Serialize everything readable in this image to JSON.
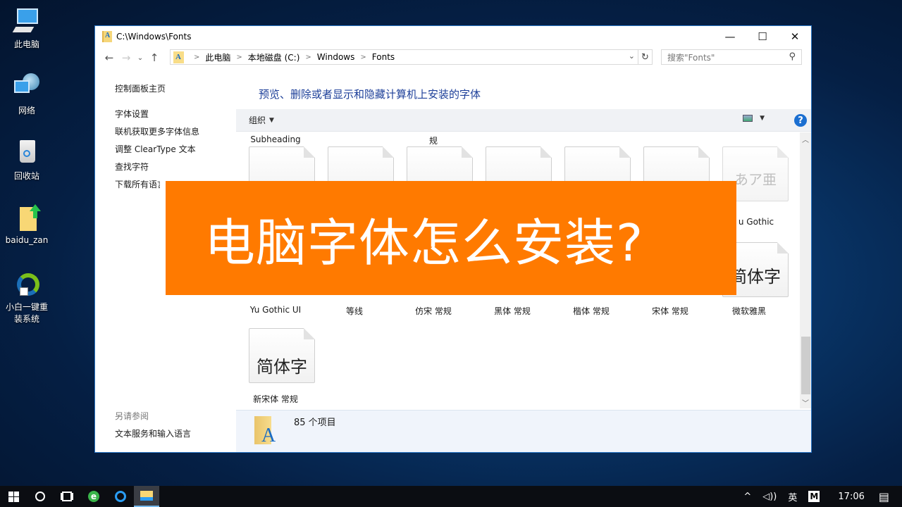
{
  "desktop": {
    "icons": [
      {
        "label": "此电脑",
        "icon": "computer-icon"
      },
      {
        "label": "网络",
        "icon": "network-icon"
      },
      {
        "label": "回收站",
        "icon": "recycle-bin-icon"
      },
      {
        "label": "baidu_zan",
        "icon": "folder-icon"
      },
      {
        "label": "小白一键重装系统",
        "icon": "reinstall-app-icon"
      }
    ]
  },
  "window": {
    "title": "C:\\Windows\\Fonts",
    "controls": {
      "minimize": "—",
      "maximize": "☐",
      "close": "✕"
    },
    "nav": {
      "back": "←",
      "forward": "→",
      "recent": "⌄",
      "up": "↑"
    },
    "breadcrumb": [
      "此电脑",
      "本地磁盘 (C:)",
      "Windows",
      "Fonts"
    ],
    "search_placeholder": "搜索\"Fonts\"",
    "left_pane": {
      "home": "控制面板主页",
      "links": [
        "字体设置",
        "联机获取更多字体信息",
        "调整 ClearType 文本",
        "查找字符",
        "下载所有语言的字体"
      ],
      "see_also_header": "另请参阅",
      "see_also_links": [
        "文本服务和输入语言"
      ]
    },
    "description": "预览、删除或者显示和隐藏计算机上安装的字体",
    "toolbar": {
      "organize": "组织",
      "help": "?"
    },
    "partial_labels": [
      "Subheading",
      "规"
    ],
    "top_row_tail_label": "u Gothic",
    "top_row_glyphs": [
      "",
      "",
      "",
      "",
      "",
      "",
      "あア亜"
    ],
    "fonts": [
      {
        "name": "Yu Gothic UI",
        "glyph": ""
      },
      {
        "name": "等线",
        "glyph": ""
      },
      {
        "name": "仿宋 常规",
        "glyph": ""
      },
      {
        "name": "黑体 常规",
        "glyph": ""
      },
      {
        "name": "楷体 常规",
        "glyph": ""
      },
      {
        "name": "宋体 常规",
        "glyph": ""
      },
      {
        "name": "微软雅黑",
        "glyph": "简体字"
      },
      {
        "name": "新宋体 常规",
        "glyph": "简体字"
      }
    ],
    "status": {
      "count": "85 个项目"
    }
  },
  "banner": {
    "text": "电脑字体怎么安装?",
    "color": "#ff7a00"
  },
  "taskbar": {
    "items": [
      "start-button",
      "cortana-button",
      "task-view-button",
      "ie-browser",
      "browser-app",
      "file-explorer"
    ],
    "tray": {
      "chevron": "^",
      "volume": "🔈",
      "ime": "英",
      "m_app": "M",
      "time": "17:06",
      "notifications": "▤"
    }
  }
}
